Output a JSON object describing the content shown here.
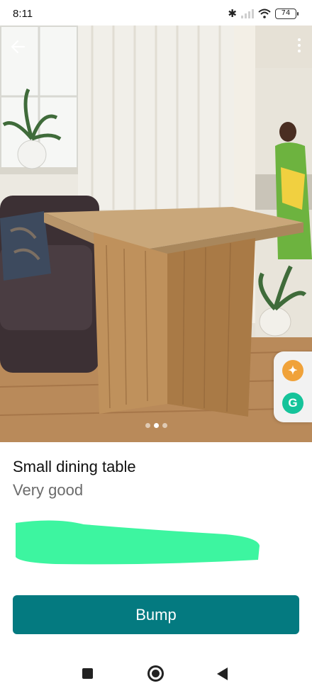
{
  "status_bar": {
    "time": "8:11",
    "battery": "74"
  },
  "listing": {
    "title": "Small dining table",
    "condition": "Very good",
    "photo_count": 3,
    "active_photo_index": 1
  },
  "actions": {
    "bump_label": "Bump"
  },
  "icons": {
    "back": "arrow-left-icon",
    "more": "more-vertical-icon",
    "accessibility": "accessibility-icon",
    "grammarly": "grammarly-icon",
    "nav_recents": "square-icon",
    "nav_home": "circle-home-icon",
    "nav_back": "triangle-back-icon"
  },
  "colors": {
    "accent": "#047a80",
    "redaction": "#3df5a0"
  }
}
